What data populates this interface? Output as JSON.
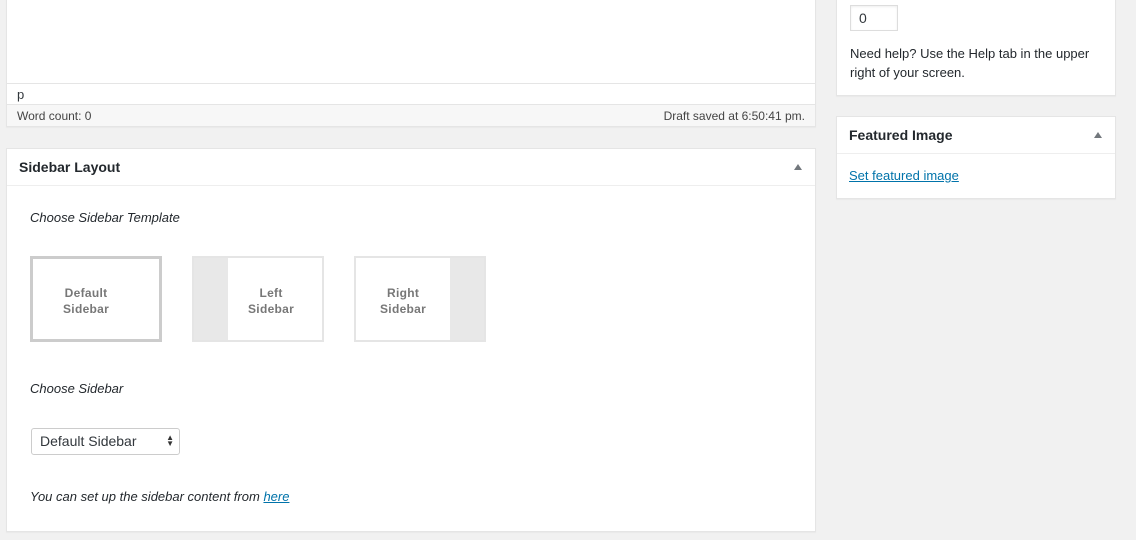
{
  "editor": {
    "path_text": "p",
    "word_count": "Word count: 0",
    "draft_status": "Draft saved at 6:50:41 pm."
  },
  "sidebar_layout": {
    "title": "Sidebar Layout",
    "choose_template_label": "Choose Sidebar Template",
    "templates": [
      {
        "line1": "Default",
        "line2": "Sidebar",
        "selected": true
      },
      {
        "line1": "Left",
        "line2": "Sidebar",
        "selected": false
      },
      {
        "line1": "Right",
        "line2": "Sidebar",
        "selected": false
      }
    ],
    "choose_sidebar_label": "Choose Sidebar",
    "select_value": "Default Sidebar",
    "hint_prefix": "You can set up the sidebar content from ",
    "hint_link": "here"
  },
  "page_attributes": {
    "order_value": "0",
    "help_text": "Need help? Use the Help tab in the upper right of your screen."
  },
  "featured_image": {
    "title": "Featured Image",
    "link_text": "Set featured image"
  },
  "icons": {
    "toggle": "triangle-up-icon",
    "select_arrows": "up-down-arrows-icon"
  },
  "colors": {
    "link": "#0073aa",
    "background": "#f1f1f1",
    "panel": "#ffffff"
  }
}
